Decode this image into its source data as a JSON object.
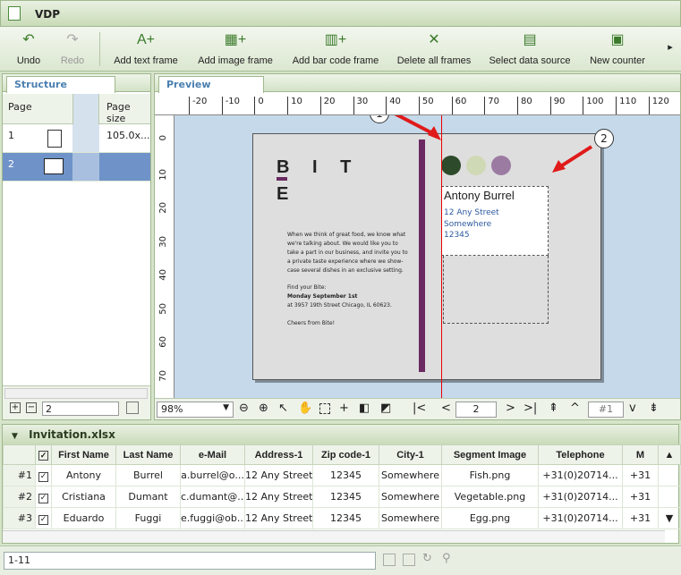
{
  "window": {
    "title": "VDP"
  },
  "toolbar": {
    "undo": "Undo",
    "redo": "Redo",
    "add_text": "Add text frame",
    "add_image": "Add image frame",
    "add_barcode": "Add bar code frame",
    "delete_all": "Delete all frames",
    "select_ds": "Select data source",
    "new_counter": "New counter",
    "more": "▸"
  },
  "structure": {
    "tab": "Structure",
    "col_page": "Page",
    "col_size": "Page size",
    "rows": [
      {
        "num": "1",
        "size": "105.0x..."
      },
      {
        "num": "2",
        "size": ""
      }
    ],
    "page_field": "2"
  },
  "preview": {
    "tab": "Preview",
    "ruler_labels": [
      "-20",
      "-10",
      "0",
      "10",
      "20",
      "30",
      "40",
      "50",
      "60",
      "70",
      "80",
      "90",
      "100",
      "110",
      "120"
    ],
    "vruler_labels": [
      "0",
      "10",
      "20",
      "30",
      "40",
      "50",
      "60",
      "70"
    ],
    "zoom": "98%",
    "page_field": "2",
    "page_field2": "#1",
    "callout1": "1",
    "callout2": "2"
  },
  "card": {
    "brand_line1": "B I T",
    "brand_line2": "E",
    "body": "When we think of great food, we know what we're talking about. We would like you to take a part in our business, and invite you to a private taste experience where we show-case several dishes in an exclusive setting.",
    "find_label": "Find your Bite:",
    "date": "Monday September 1st",
    "address": "at 3957 19th Street Chicago, IL 60623.",
    "cheers": "Cheers from Bite!",
    "name": "Antony Burrel",
    "street": "12 Any Street Somewhere",
    "zip": "12345",
    "accent_color": "#6b2a62"
  },
  "table": {
    "title": "Invitation.xlsx",
    "headers": [
      "First Name",
      "Last Name",
      "e-Mail",
      "Address-1",
      "Zip code-1",
      "City-1",
      "Segment Image",
      "Telephone",
      "M"
    ],
    "rows": [
      {
        "n": "#1",
        "cells": [
          "Antony",
          "Burrel",
          "a.burrel@o...",
          "12 Any Street",
          "12345",
          "Somewhere",
          "Fish.png",
          "+31(0)20714...",
          "+31"
        ]
      },
      {
        "n": "#2",
        "cells": [
          "Cristiana",
          "Dumant",
          "c.dumant@...",
          "12 Any Street",
          "12345",
          "Somewhere",
          "Vegetable.png",
          "+31(0)20714...",
          "+31"
        ]
      },
      {
        "n": "#3",
        "cells": [
          "Eduardo",
          "Fuggi",
          "e.fuggi@ob...",
          "12 Any Street",
          "12345",
          "Somewhere",
          "Egg.png",
          "+31(0)20714...",
          "+31"
        ]
      }
    ]
  },
  "status": {
    "range": "1-11"
  }
}
